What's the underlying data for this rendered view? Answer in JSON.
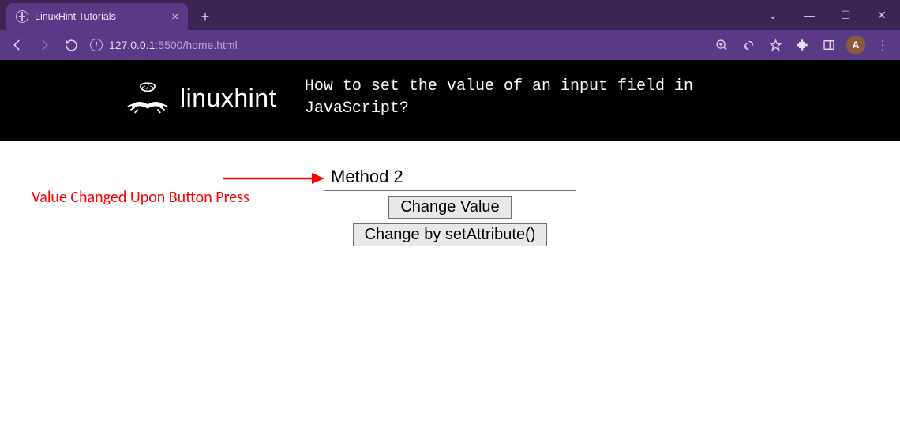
{
  "browser": {
    "tab_title": "LinuxHint Tutorials",
    "url_host": "127.0.0.1",
    "url_port_path": ":5500/home.html",
    "avatar_letter": "A"
  },
  "header": {
    "brand": "linuxhint",
    "headline_line1": "How to set the value of an input field in",
    "headline_line2": "JavaScript?"
  },
  "demo": {
    "input_value": "Method 2",
    "btn1_label": "Change Value",
    "btn2_label": "Change by setAttribute()"
  },
  "annotation": {
    "text": "Value Changed Upon Button Press"
  }
}
